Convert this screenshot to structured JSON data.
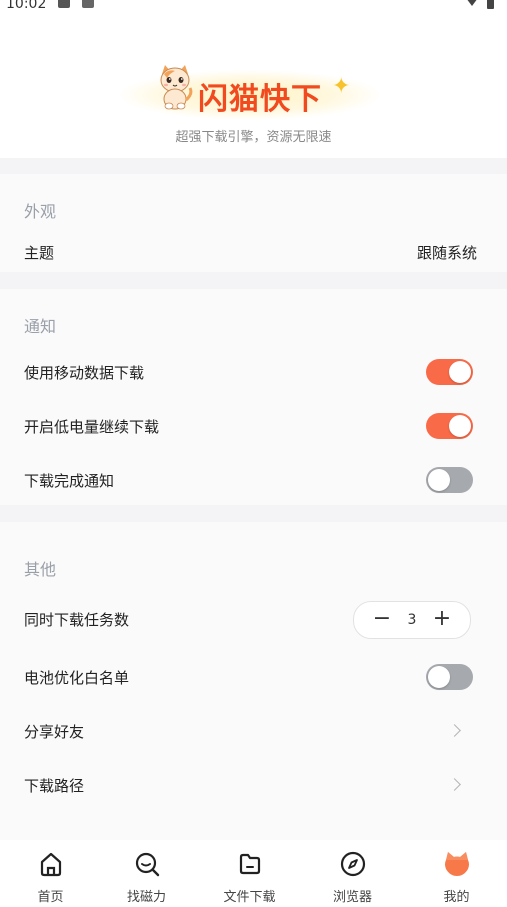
{
  "status": {
    "time": "10:02"
  },
  "brand": {
    "name": "闪猫快下",
    "slogan": "超强下载引擎，资源无限速"
  },
  "appearance": {
    "title": "外观",
    "theme_label": "主题",
    "theme_value": "跟随系统"
  },
  "notify": {
    "title": "通知",
    "items": [
      {
        "label": "使用移动数据下载",
        "on": true
      },
      {
        "label": "开启低电量继续下载",
        "on": true
      },
      {
        "label": "下载完成通知",
        "on": false
      }
    ]
  },
  "other": {
    "title": "其他",
    "concurrent_label": "同时下载任务数",
    "concurrent_value": "3",
    "battery_label": "电池优化白名单",
    "battery_on": false,
    "share_label": "分享好友",
    "path_label": "下载路径"
  },
  "nav": {
    "items": [
      {
        "label": "首页",
        "icon": "home-icon"
      },
      {
        "label": "找磁力",
        "icon": "magnet-search-icon"
      },
      {
        "label": "文件下载",
        "icon": "file-download-icon"
      },
      {
        "label": "浏览器",
        "icon": "compass-icon"
      },
      {
        "label": "我的",
        "icon": "cat-profile-icon"
      }
    ]
  },
  "colors": {
    "accent": "#f96a48",
    "brand": "#f04a1e",
    "toggle_off": "#a6a9ad"
  }
}
